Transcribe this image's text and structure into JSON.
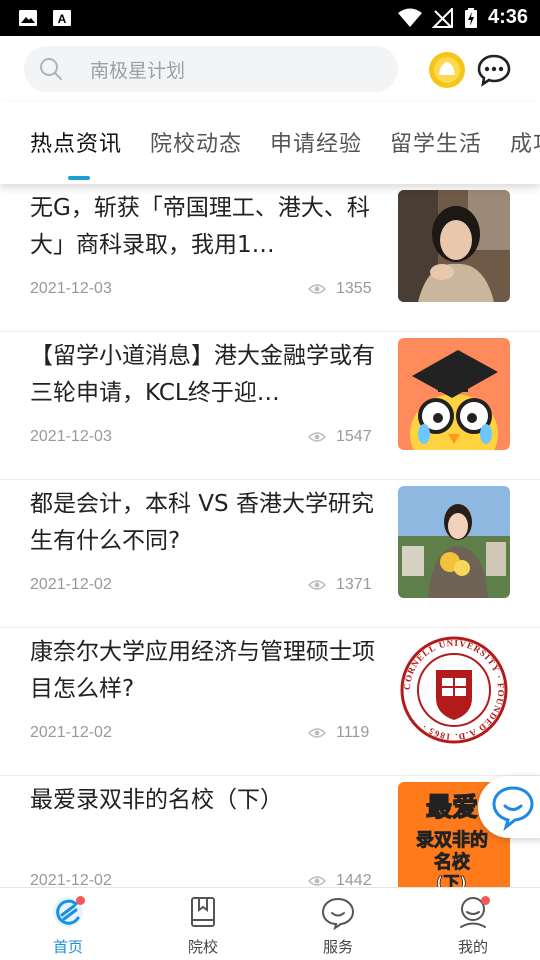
{
  "status_bar": {
    "time": "4:36"
  },
  "search": {
    "placeholder": "南极星计划"
  },
  "tabs": [
    {
      "label": "热点资讯",
      "active": true
    },
    {
      "label": "院校动态",
      "active": false
    },
    {
      "label": "申请经验",
      "active": false
    },
    {
      "label": "留学生活",
      "active": false
    },
    {
      "label": "成功",
      "active": false
    }
  ],
  "articles": [
    {
      "title": "无G，斩获「帝国理工、港大、科大」商科录取，我用1…",
      "date": "2021-12-03",
      "views": "1355",
      "thumb": "woman-portrait"
    },
    {
      "title": "【留学小道消息】港大金融学或有三轮申请，KCL终于迎…",
      "date": "2021-12-03",
      "views": "1547",
      "thumb": "cartoon-graduate"
    },
    {
      "title": "都是会计，本科 VS 香港大学研究生有什么不同?",
      "date": "2021-12-02",
      "views": "1371",
      "thumb": "woman-flowers"
    },
    {
      "title": "康奈尔大学应用经济与管理硕士项目怎么样?",
      "date": "2021-12-02",
      "views": "1119",
      "thumb": "cornell-seal"
    },
    {
      "title": "最爱录双非的名校（下）",
      "date": "2021-12-02",
      "views": "1442",
      "thumb": "poster-text"
    }
  ],
  "thumb_text": {
    "cornell_ring": "CORNELL UNIVERSITY · FOUNDED A.D. 1865 ·",
    "poster_line1": "最爱",
    "poster_line2": "录双非的",
    "poster_line3": "名校",
    "poster_line4": "(下)"
  },
  "bottom_nav": [
    {
      "label": "首页",
      "active": true,
      "badge": true
    },
    {
      "label": "院校",
      "active": false,
      "badge": false
    },
    {
      "label": "服务",
      "active": false,
      "badge": false
    },
    {
      "label": "我的",
      "active": false,
      "badge": true
    }
  ],
  "colors": {
    "accent": "#1aa0d4",
    "nav_active": "#1b8fe3",
    "badge": "#f05a5a",
    "coin": "#f5c518"
  }
}
